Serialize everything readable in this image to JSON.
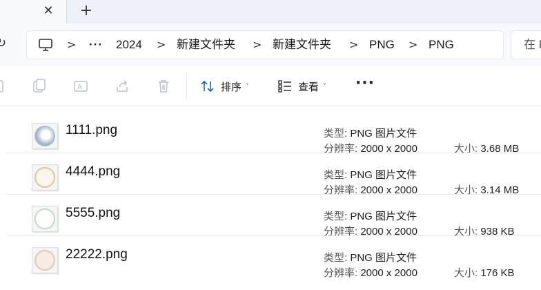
{
  "tabs": {
    "close_glyph": "✕",
    "new_tab_glyph": "+"
  },
  "address": {
    "refresh_glyph": "↻",
    "breadcrumbs": [
      "2024",
      "新建文件夹",
      "新建文件夹",
      "PNG",
      "PNG"
    ],
    "overflow": "···",
    "separator": ">",
    "search_placeholder": "在 P"
  },
  "toolbar": {
    "sort_label": "排序",
    "view_label": "查看",
    "caret": "˅",
    "more": "···"
  },
  "files": [
    {
      "name": "1111.png",
      "type_key": "类型:",
      "type_val": "PNG 图片文件",
      "res_key": "分辨率:",
      "res_val": "2000 x 2000",
      "size_key": "大小:",
      "size_val": "3.68 MB",
      "thumb_color": "#9bb3c4"
    },
    {
      "name": "4444.png",
      "type_key": "类型:",
      "type_val": "PNG 图片文件",
      "res_key": "分辨率:",
      "res_val": "2000 x 2000",
      "size_key": "大小:",
      "size_val": "3.14 MB",
      "thumb_color": "#d9b88a"
    },
    {
      "name": "5555.png",
      "type_key": "类型:",
      "type_val": "PNG 图片文件",
      "res_key": "分辨率:",
      "res_val": "2000 x 2000",
      "size_key": "大小:",
      "size_val": "938 KB",
      "thumb_color": "#8fc4a3"
    },
    {
      "name": "22222.png",
      "type_key": "类型:",
      "type_val": "PNG 图片文件",
      "res_key": "分辨率:",
      "res_val": "2000 x 2000",
      "size_key": "大小:",
      "size_val": "176 KB",
      "thumb_color": "#d8b8a6"
    }
  ]
}
